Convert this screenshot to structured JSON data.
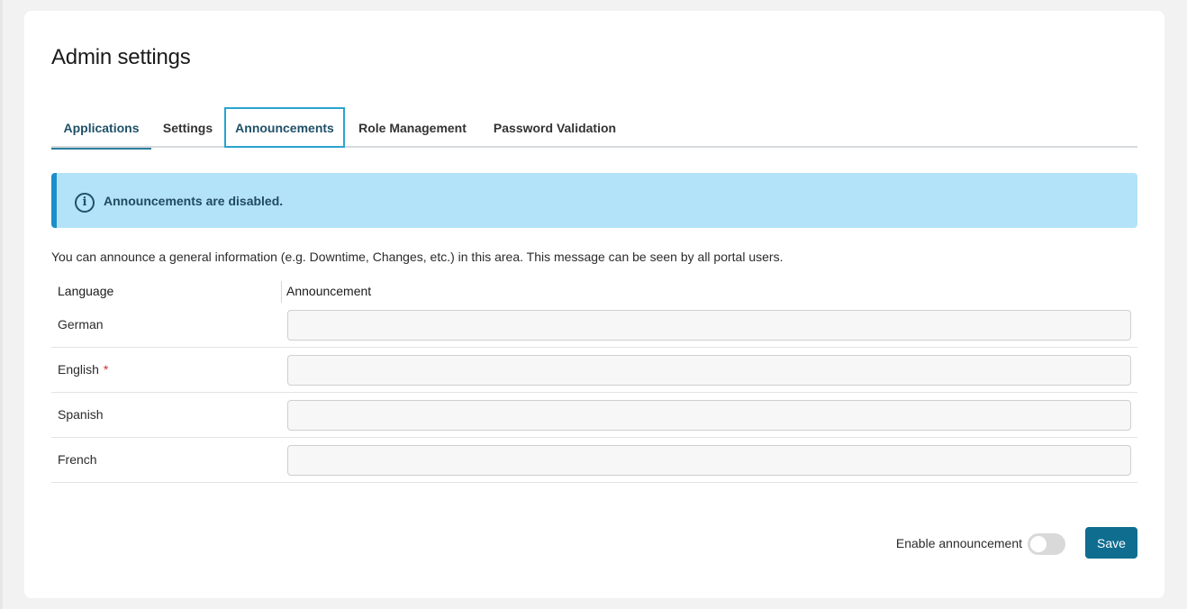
{
  "page": {
    "title": "Admin settings"
  },
  "tabs": [
    {
      "label": "Applications"
    },
    {
      "label": "Settings"
    },
    {
      "label": "Announcements"
    },
    {
      "label": "Role Management"
    },
    {
      "label": "Password Validation"
    }
  ],
  "alert": {
    "icon": "info-icon",
    "message": "Announcements are disabled."
  },
  "description": "You can announce a general information (e.g. Downtime, Changes, etc.) in this area. This message can be seen by all portal users.",
  "table": {
    "headers": {
      "language": "Language",
      "announcement": "Announcement"
    },
    "rows": [
      {
        "language": "German",
        "required": "",
        "value": ""
      },
      {
        "language": "English",
        "required": "*",
        "value": ""
      },
      {
        "language": "Spanish",
        "required": "",
        "value": ""
      },
      {
        "language": "French",
        "required": "",
        "value": ""
      }
    ]
  },
  "footer": {
    "toggle_label": "Enable announcement",
    "toggle_state": "off",
    "save_label": "Save"
  },
  "colors": {
    "accent": "#0f6d8f",
    "alert_bg": "#b3e3f8",
    "alert_border": "#1b8fc9",
    "active_tab_border": "#2aa4cf",
    "required": "#d32f2f"
  }
}
